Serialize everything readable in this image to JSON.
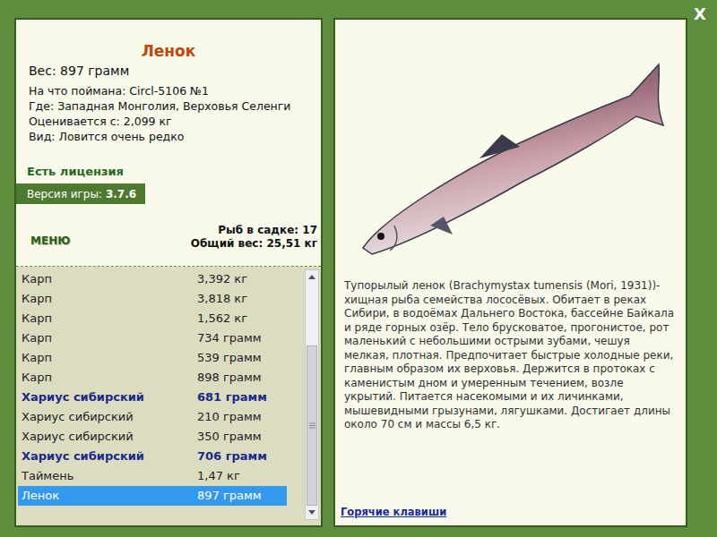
{
  "window": {
    "close": "X"
  },
  "fish": {
    "title": "Ленок",
    "weight": "Вес: 897 грамм",
    "details": [
      "На что поймана: Circl-5106 №1",
      "Где: Западная Монголия, Верховья Селенги",
      "Оценивается с: 2,099 кг",
      "Вид: Ловится очень редко"
    ],
    "license": "Есть лицензия",
    "version_label": "Версия игры:",
    "version": "3.7.6"
  },
  "menu": "МЕНЮ",
  "keepnet": {
    "count": "Рыб в садке: 17",
    "total": "Общий вес: 25,51 кг"
  },
  "catch_list": [
    {
      "name": "Карп",
      "weight": "3,392 кг",
      "highlighted": false,
      "selected": false
    },
    {
      "name": "Карп",
      "weight": "3,818 кг",
      "highlighted": false,
      "selected": false
    },
    {
      "name": "Карп",
      "weight": "1,562 кг",
      "highlighted": false,
      "selected": false
    },
    {
      "name": "Карп",
      "weight": "734 грамм",
      "highlighted": false,
      "selected": false
    },
    {
      "name": "Карп",
      "weight": "539 грамм",
      "highlighted": false,
      "selected": false
    },
    {
      "name": "Карп",
      "weight": "898 грамм",
      "highlighted": false,
      "selected": false
    },
    {
      "name": "Хариус сибирский",
      "weight": "681 грамм",
      "highlighted": true,
      "selected": false
    },
    {
      "name": "Хариус сибирский",
      "weight": "210 грамм",
      "highlighted": false,
      "selected": false
    },
    {
      "name": "Хариус сибирский",
      "weight": "350 грамм",
      "highlighted": false,
      "selected": false
    },
    {
      "name": "Хариус сибирский",
      "weight": "706 грамм",
      "highlighted": true,
      "selected": false
    },
    {
      "name": "Таймень",
      "weight": "1,47 кг",
      "highlighted": false,
      "selected": false
    },
    {
      "name": "Ленок",
      "weight": "897 грамм",
      "highlighted": false,
      "selected": true
    }
  ],
  "scrollbar": {
    "level": 1,
    "thumb": 0.72
  },
  "description": {
    "text": "Тупорылый ленок (Brachymystax tumensis (Mori, 1931))- хищная рыба семейства лососёвых. Обитает в реках Сибири, в водоёмах Дальнего Востока, бассейне Байкала и ряде горных озёр. Тело брусковатое, прогонистое, рот маленький с небольшими острыми зубами, чешуя мелкая, плотная. Предпочитает быстрые холодные реки, главным образом их верховья. Держится в протоках с каменистым дном и умеренным течением, возле укрытий. Питается насекомыми и их личинками, мышевидными грызунами, лягушками. Достигает длины около 70 см и массы 6,5 кг.",
    "hotkeys": "Горячие клавиши"
  }
}
